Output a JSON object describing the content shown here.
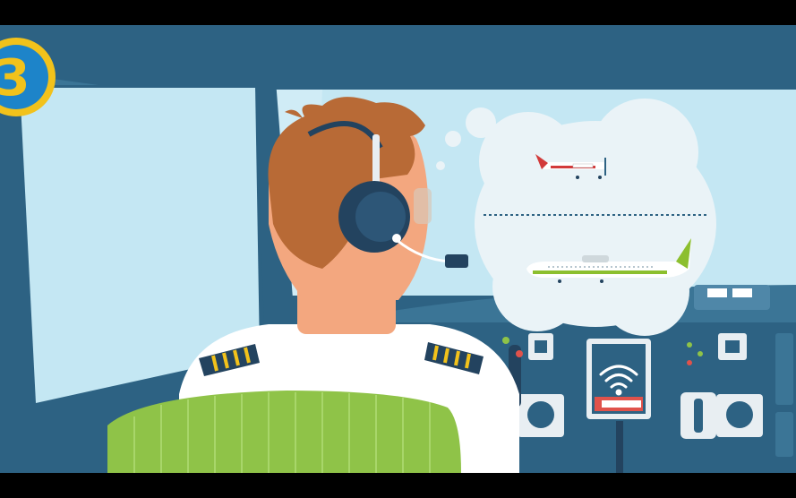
{
  "badge": {
    "number": "3"
  },
  "colors": {
    "frame": "#000000",
    "cockpit_dark": "#2d6283",
    "cockpit_mid": "#3b7596",
    "sky": "#c4e7f3",
    "hair": "#b86a36",
    "skin": "#f3a77f",
    "headset": "#23435f",
    "shirt": "#ffffff",
    "seat": "#8fc348",
    "badge_fill": "#1d84c9",
    "badge_ring": "#f2c21b",
    "thought_bubble": "#eaf3f7",
    "small_plane_red": "#d23a3a",
    "large_plane_green": "#8cbf2e",
    "panel_red": "#e0524b"
  },
  "icons": {
    "badge": "number-3-badge",
    "headset": "headset-icon",
    "thought": "thought-bubble-icon",
    "small_plane": "small-propeller-plane-icon",
    "large_plane": "regional-airliner-icon",
    "wifi": "wifi-icon"
  }
}
